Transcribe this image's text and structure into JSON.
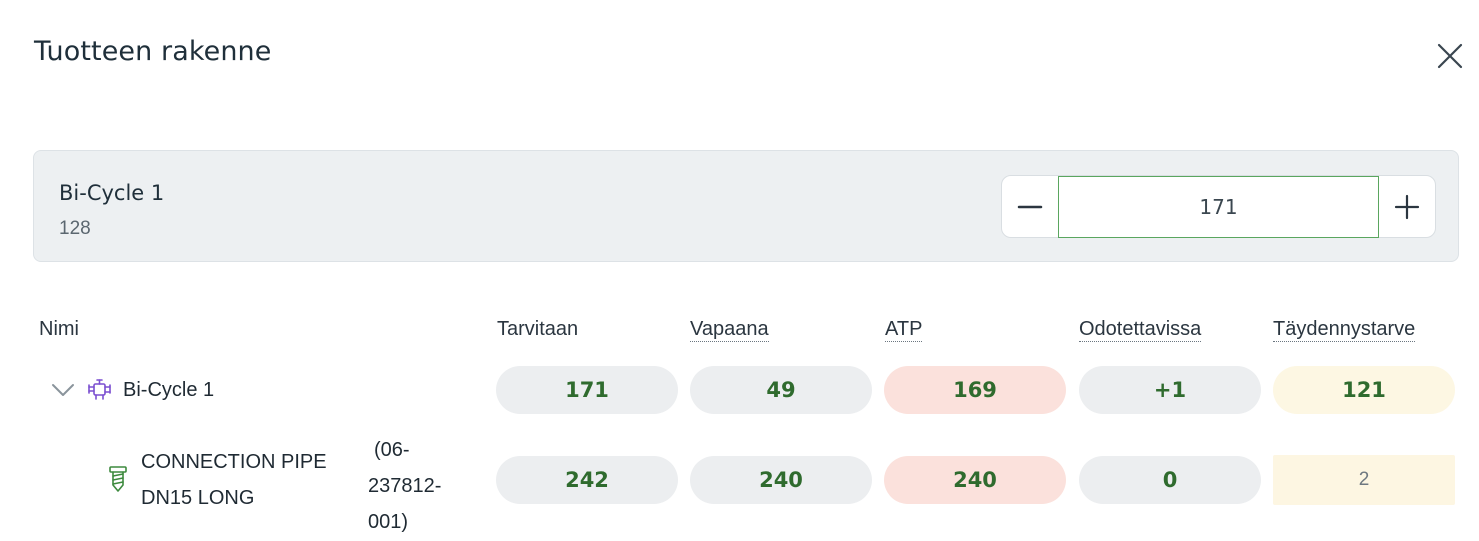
{
  "dialog": {
    "title": "Tuotteen rakenne"
  },
  "product": {
    "name": "Bi-Cycle 1",
    "code": "128",
    "quantity": "171"
  },
  "columns": {
    "name": "Nimi",
    "required": "Tarvitaan",
    "available": "Vapaana",
    "atp": "ATP",
    "expected": "Odotettavissa",
    "replenish": "Täydennystarve"
  },
  "rows": [
    {
      "name": "Bi-Cycle 1",
      "icon": "bicycle-icon",
      "required": "171",
      "available": "49",
      "atp": "169",
      "expected": "+1",
      "replenish": "121"
    },
    {
      "name_line1": "CONNECTION PIPE",
      "name_line2": "DN15 LONG",
      "code_line1": "(06-",
      "code_line2": "237812-",
      "code_line3": "001)",
      "icon": "screw-icon",
      "required": "242",
      "available": "240",
      "atp": "240",
      "expected": "0",
      "replenish": "2"
    }
  ],
  "colors": {
    "value_green": "#2f6b2e",
    "pill_gray": "#eceef0",
    "pill_red": "#fbe1dc",
    "pill_yellow": "#fdf7e3",
    "input_border": "#5aa65f",
    "icon_purple": "#7b4fd0",
    "icon_green": "#3d8a3e"
  }
}
